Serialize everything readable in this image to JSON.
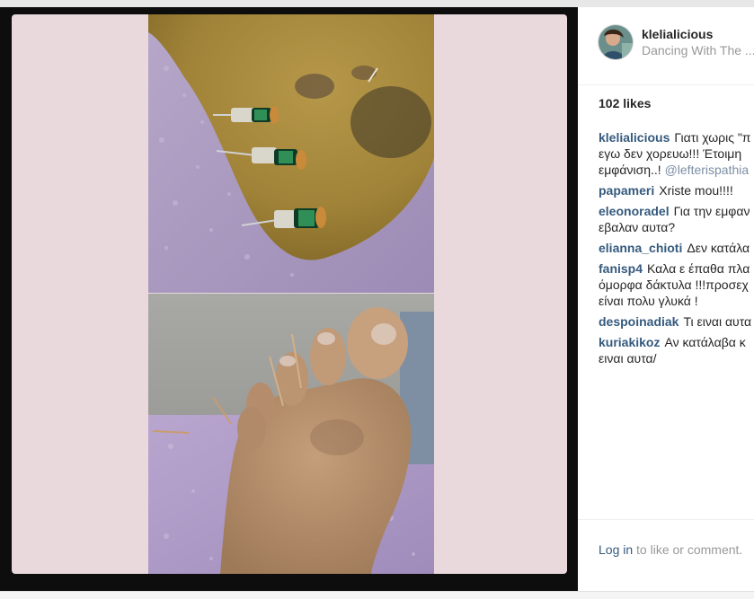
{
  "post": {
    "username": "klelialicious",
    "location": "Dancing With The ...",
    "likes": "102 likes",
    "caption": {
      "user": "klelialicious",
      "line1": "Γιατι χωρις \"π",
      "line2": "εγω δεν χορευω!!! Έτοιμη",
      "line3_text": "εμφάνιση..! ",
      "line3_mention": "@lefterispathia"
    },
    "comments": [
      {
        "user": "papameri",
        "lines": [
          "Xriste mou!!!!"
        ]
      },
      {
        "user": "eleonoradel",
        "lines": [
          "Για την εμφαν",
          "εβαλαν αυτα?"
        ]
      },
      {
        "user": "elianna_chioti",
        "lines": [
          "Δεν κατάλα"
        ]
      },
      {
        "user": "fanisp4",
        "lines": [
          "Καλα ε έπαθα πλα",
          "όμορφα δάκτυλα !!!προσεχ",
          "είναι πολυ γλυκά !"
        ]
      },
      {
        "user": "despoinadiak",
        "lines": [
          "Τι ειναι αυτα"
        ]
      },
      {
        "user": "kuriakikoz",
        "lines": [
          "Αν κατάλαβα κ",
          "ειναι αυτα/"
        ]
      }
    ],
    "footer": {
      "login_link": "Log in",
      "login_rest": " to like or comment."
    }
  },
  "colors": {
    "link_blue": "#355a7e",
    "mention_blue": "#7c8ea4",
    "muted_gray": "#999999",
    "text_dark": "#262626",
    "photo_bg": "#0d0d0d",
    "card_pink": "#e9d9dc"
  },
  "icons": {
    "avatar": "profile-avatar-icon"
  }
}
